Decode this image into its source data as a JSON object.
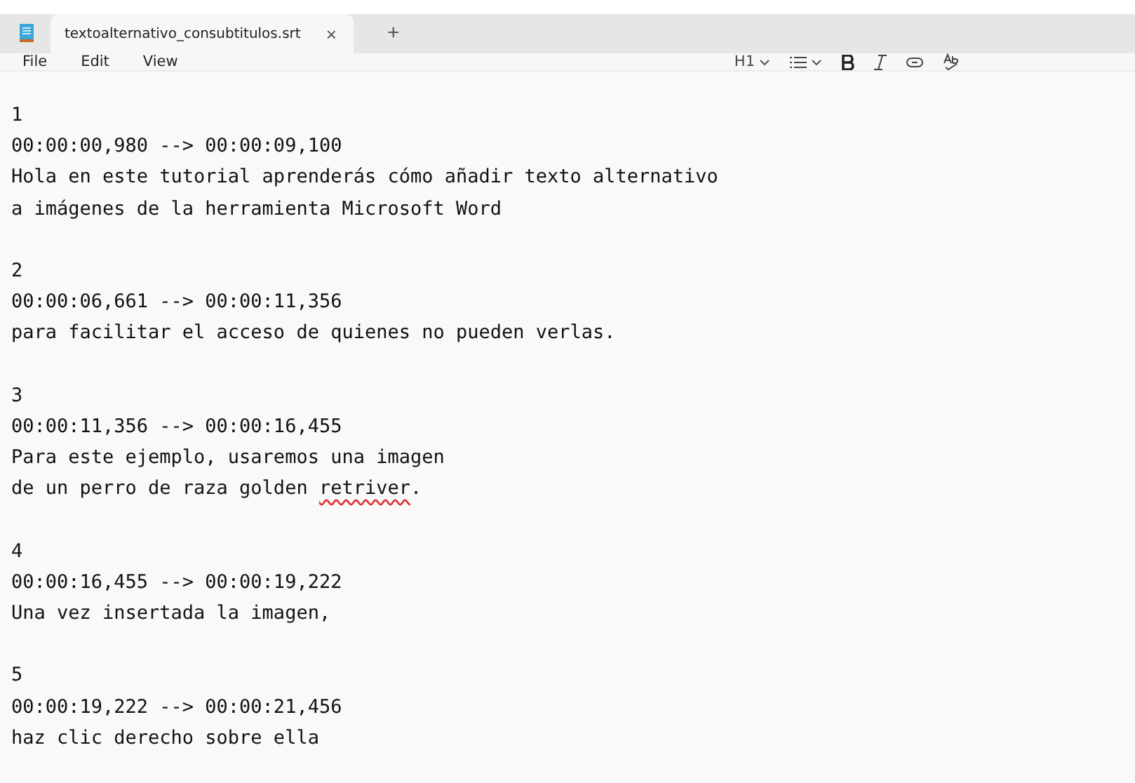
{
  "tab": {
    "title": "textoalternativo_consubtitulos.srt",
    "close": "×",
    "selected": true
  },
  "new_tab": "+",
  "menu": [
    "File",
    "Edit",
    "View"
  ],
  "format_toolbar": {
    "heading": "H1"
  },
  "subtitles": [
    {
      "number": "1",
      "timing": "00:00:00,980 --> 00:00:09,100",
      "lines": [
        [
          {
            "text": "Hola en este tutorial aprenderás cómo añadir texto alternativo"
          }
        ],
        [
          {
            "text": "a imágenes de la herramienta Microsoft Word"
          }
        ]
      ]
    },
    {
      "number": "2",
      "timing": "00:00:06,661 --> 00:00:11,356",
      "lines": [
        [
          {
            "text": "para facilitar el acceso de quienes no pueden verlas."
          }
        ]
      ]
    },
    {
      "number": "3",
      "timing": "00:00:11,356 --> 00:00:16,455",
      "lines": [
        [
          {
            "text": "Para este ejemplo, usaremos una imagen"
          }
        ],
        [
          {
            "text": "de un perro de raza golden "
          },
          {
            "text": "retriver",
            "misspelled": true
          },
          {
            "text": "."
          }
        ]
      ]
    },
    {
      "number": "4",
      "timing": "00:00:16,455 --> 00:00:19,222",
      "lines": [
        [
          {
            "text": "Una vez insertada la imagen,"
          }
        ]
      ]
    },
    {
      "number": "5",
      "timing": "00:00:19,222 --> 00:00:21,456",
      "lines": [
        [
          {
            "text": "haz clic derecho sobre ella"
          }
        ]
      ]
    }
  ]
}
